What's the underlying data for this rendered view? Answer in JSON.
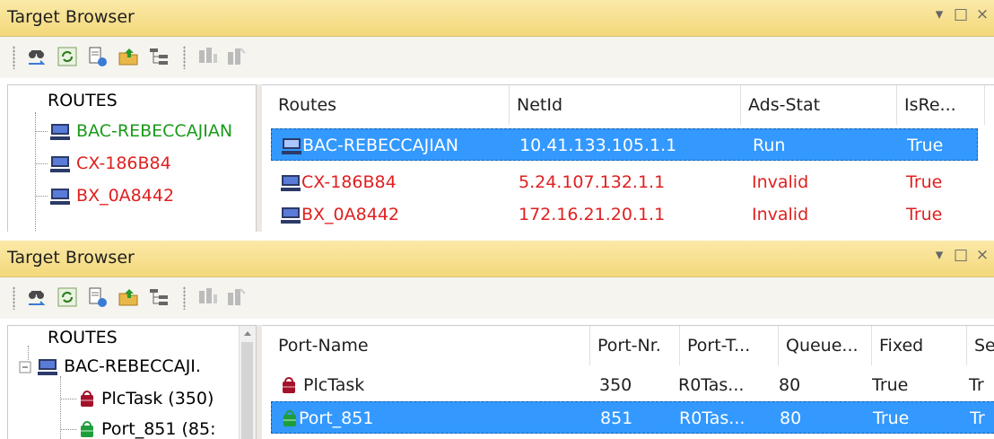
{
  "panel1": {
    "title": "Target Browser",
    "tree": {
      "root": "ROUTES",
      "items": [
        {
          "label": "BAC-REBECCAJIAN",
          "color": "#1a9a1a"
        },
        {
          "label": "CX-186B84",
          "color": "#e02020"
        },
        {
          "label": "BX_0A8442",
          "color": "#e02020"
        }
      ]
    },
    "columns": [
      "Routes",
      "NetId",
      "Ads-Stat",
      "IsRe..."
    ],
    "rows": [
      {
        "route": "BAC-REBECCAJIAN",
        "netid": "10.41.133.105.1.1",
        "ads": "Run",
        "isre": "True",
        "selected": true
      },
      {
        "route": "CX-186B84",
        "netid": "5.24.107.132.1.1",
        "ads": "Invalid",
        "isre": "True",
        "selected": false
      },
      {
        "route": "BX_0A8442",
        "netid": "172.16.21.20.1.1",
        "ads": "Invalid",
        "isre": "True",
        "selected": false
      }
    ]
  },
  "panel2": {
    "title": "Target Browser",
    "tree": {
      "root": "ROUTES",
      "device": "BAC-REBECCAJI.",
      "items": [
        {
          "label": "PlcTask (350)",
          "icon": "plc-task-red-icon"
        },
        {
          "label": "Port_851 (85:",
          "icon": "port-green-icon"
        }
      ]
    },
    "columns": [
      "Port-Name",
      "Port-Nr.",
      "Port-T...",
      "Queue...",
      "Fixed",
      "Se"
    ],
    "rows": [
      {
        "name": "PlcTask",
        "nr": "350",
        "type": "R0Tas...",
        "queue": "80",
        "fixed": "True",
        "se": "Tr",
        "selected": false
      },
      {
        "name": "Port_851",
        "nr": "851",
        "type": "R0Tas...",
        "queue": "80",
        "fixed": "True",
        "se": "Tr",
        "selected": true
      }
    ]
  },
  "window_controls": {
    "dropdown": "▾",
    "maximize": "□",
    "close": "×"
  },
  "colors": {
    "selection": "#3399ff",
    "invalid": "#e02020",
    "online": "#1a9a1a"
  }
}
